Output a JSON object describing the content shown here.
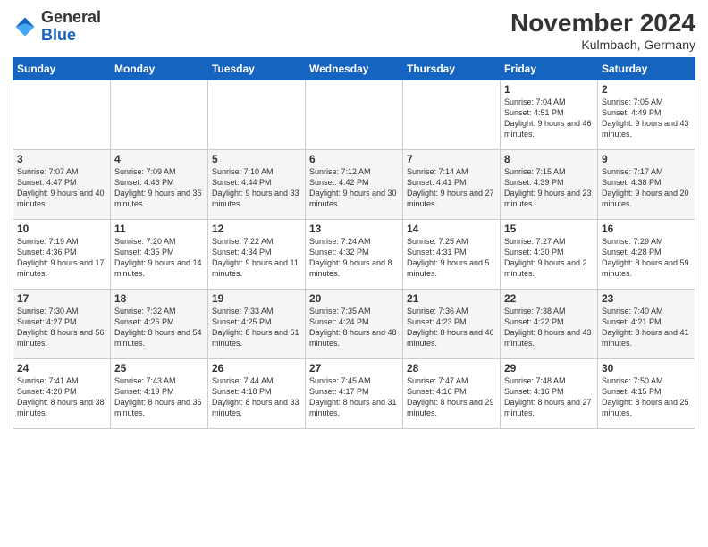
{
  "header": {
    "logo_general": "General",
    "logo_blue": "Blue",
    "month_title": "November 2024",
    "location": "Kulmbach, Germany"
  },
  "weekdays": [
    "Sunday",
    "Monday",
    "Tuesday",
    "Wednesday",
    "Thursday",
    "Friday",
    "Saturday"
  ],
  "weeks": [
    [
      {
        "day": "",
        "info": ""
      },
      {
        "day": "",
        "info": ""
      },
      {
        "day": "",
        "info": ""
      },
      {
        "day": "",
        "info": ""
      },
      {
        "day": "",
        "info": ""
      },
      {
        "day": "1",
        "info": "Sunrise: 7:04 AM\nSunset: 4:51 PM\nDaylight: 9 hours\nand 46 minutes."
      },
      {
        "day": "2",
        "info": "Sunrise: 7:05 AM\nSunset: 4:49 PM\nDaylight: 9 hours\nand 43 minutes."
      }
    ],
    [
      {
        "day": "3",
        "info": "Sunrise: 7:07 AM\nSunset: 4:47 PM\nDaylight: 9 hours\nand 40 minutes."
      },
      {
        "day": "4",
        "info": "Sunrise: 7:09 AM\nSunset: 4:46 PM\nDaylight: 9 hours\nand 36 minutes."
      },
      {
        "day": "5",
        "info": "Sunrise: 7:10 AM\nSunset: 4:44 PM\nDaylight: 9 hours\nand 33 minutes."
      },
      {
        "day": "6",
        "info": "Sunrise: 7:12 AM\nSunset: 4:42 PM\nDaylight: 9 hours\nand 30 minutes."
      },
      {
        "day": "7",
        "info": "Sunrise: 7:14 AM\nSunset: 4:41 PM\nDaylight: 9 hours\nand 27 minutes."
      },
      {
        "day": "8",
        "info": "Sunrise: 7:15 AM\nSunset: 4:39 PM\nDaylight: 9 hours\nand 23 minutes."
      },
      {
        "day": "9",
        "info": "Sunrise: 7:17 AM\nSunset: 4:38 PM\nDaylight: 9 hours\nand 20 minutes."
      }
    ],
    [
      {
        "day": "10",
        "info": "Sunrise: 7:19 AM\nSunset: 4:36 PM\nDaylight: 9 hours\nand 17 minutes."
      },
      {
        "day": "11",
        "info": "Sunrise: 7:20 AM\nSunset: 4:35 PM\nDaylight: 9 hours\nand 14 minutes."
      },
      {
        "day": "12",
        "info": "Sunrise: 7:22 AM\nSunset: 4:34 PM\nDaylight: 9 hours\nand 11 minutes."
      },
      {
        "day": "13",
        "info": "Sunrise: 7:24 AM\nSunset: 4:32 PM\nDaylight: 9 hours\nand 8 minutes."
      },
      {
        "day": "14",
        "info": "Sunrise: 7:25 AM\nSunset: 4:31 PM\nDaylight: 9 hours\nand 5 minutes."
      },
      {
        "day": "15",
        "info": "Sunrise: 7:27 AM\nSunset: 4:30 PM\nDaylight: 9 hours\nand 2 minutes."
      },
      {
        "day": "16",
        "info": "Sunrise: 7:29 AM\nSunset: 4:28 PM\nDaylight: 8 hours\nand 59 minutes."
      }
    ],
    [
      {
        "day": "17",
        "info": "Sunrise: 7:30 AM\nSunset: 4:27 PM\nDaylight: 8 hours\nand 56 minutes."
      },
      {
        "day": "18",
        "info": "Sunrise: 7:32 AM\nSunset: 4:26 PM\nDaylight: 8 hours\nand 54 minutes."
      },
      {
        "day": "19",
        "info": "Sunrise: 7:33 AM\nSunset: 4:25 PM\nDaylight: 8 hours\nand 51 minutes."
      },
      {
        "day": "20",
        "info": "Sunrise: 7:35 AM\nSunset: 4:24 PM\nDaylight: 8 hours\nand 48 minutes."
      },
      {
        "day": "21",
        "info": "Sunrise: 7:36 AM\nSunset: 4:23 PM\nDaylight: 8 hours\nand 46 minutes."
      },
      {
        "day": "22",
        "info": "Sunrise: 7:38 AM\nSunset: 4:22 PM\nDaylight: 8 hours\nand 43 minutes."
      },
      {
        "day": "23",
        "info": "Sunrise: 7:40 AM\nSunset: 4:21 PM\nDaylight: 8 hours\nand 41 minutes."
      }
    ],
    [
      {
        "day": "24",
        "info": "Sunrise: 7:41 AM\nSunset: 4:20 PM\nDaylight: 8 hours\nand 38 minutes."
      },
      {
        "day": "25",
        "info": "Sunrise: 7:43 AM\nSunset: 4:19 PM\nDaylight: 8 hours\nand 36 minutes."
      },
      {
        "day": "26",
        "info": "Sunrise: 7:44 AM\nSunset: 4:18 PM\nDaylight: 8 hours\nand 33 minutes."
      },
      {
        "day": "27",
        "info": "Sunrise: 7:45 AM\nSunset: 4:17 PM\nDaylight: 8 hours\nand 31 minutes."
      },
      {
        "day": "28",
        "info": "Sunrise: 7:47 AM\nSunset: 4:16 PM\nDaylight: 8 hours\nand 29 minutes."
      },
      {
        "day": "29",
        "info": "Sunrise: 7:48 AM\nSunset: 4:16 PM\nDaylight: 8 hours\nand 27 minutes."
      },
      {
        "day": "30",
        "info": "Sunrise: 7:50 AM\nSunset: 4:15 PM\nDaylight: 8 hours\nand 25 minutes."
      }
    ]
  ]
}
